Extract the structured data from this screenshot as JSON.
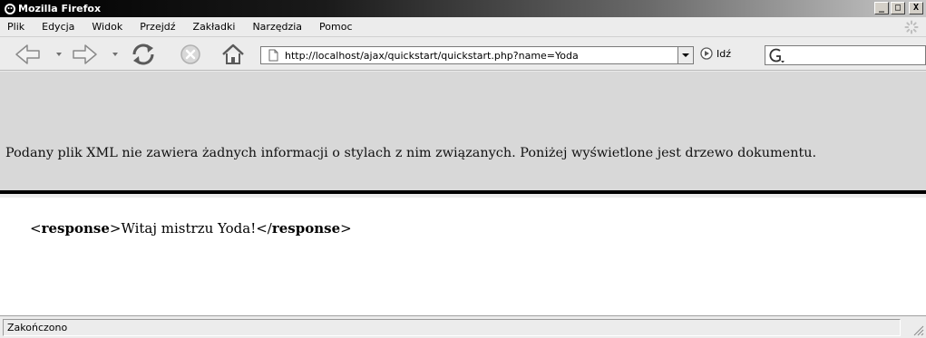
{
  "window": {
    "title": "Mozilla Firefox",
    "buttons": {
      "minimize": "_",
      "maximize": "□",
      "close": "X"
    }
  },
  "menubar": {
    "items": [
      {
        "label": "Plik",
        "name": "menu-plik"
      },
      {
        "label": "Edycja",
        "name": "menu-edycja"
      },
      {
        "label": "Widok",
        "name": "menu-widok"
      },
      {
        "label": "Przejdź",
        "name": "menu-przejdz"
      },
      {
        "label": "Zakładki",
        "name": "menu-zakladki"
      },
      {
        "label": "Narzędzia",
        "name": "menu-narzedzia"
      },
      {
        "label": "Pomoc",
        "name": "menu-pomoc"
      }
    ]
  },
  "toolbar": {
    "icons": {
      "back": "back-arrow-icon",
      "forward": "forward-arrow-icon",
      "reload": "reload-icon",
      "stop": "stop-icon",
      "home": "home-icon",
      "go": "go-icon",
      "search_engine": "google-icon"
    },
    "address": "http://localhost/ajax/quickstart/quickstart.php?name=Yoda",
    "go_label": "Idź",
    "search_value": ""
  },
  "xml_banner": {
    "text": "Podany plik XML nie zawiera żadnych informacji o stylach z nim związanych. Poniżej wyświetlone jest drzewo dokumentu."
  },
  "document": {
    "open_tag": "response",
    "text": "Witaj mistrzu Yoda!",
    "close_tag": "response"
  },
  "statusbar": {
    "text": "Zakończono"
  },
  "colors": {
    "chrome": "#ececec",
    "banner": "#d8d8d8",
    "banner_border": "#000000",
    "titlebar_start": "#000000"
  }
}
